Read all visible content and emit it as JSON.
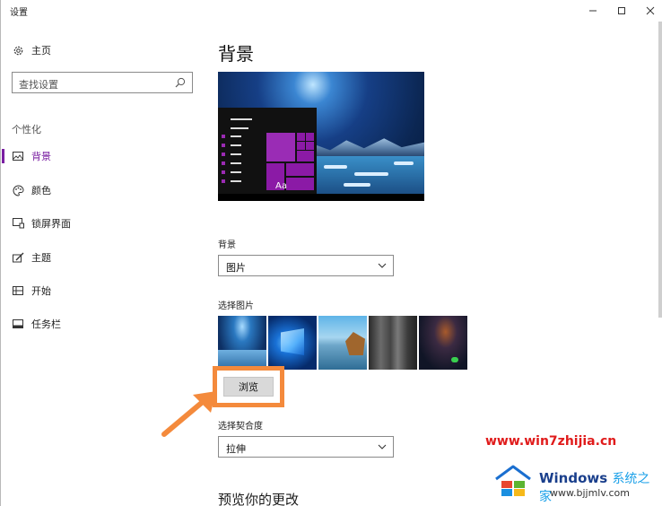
{
  "window": {
    "title": "设置"
  },
  "sidebar": {
    "home_label": "主页",
    "search_placeholder": "查找设置",
    "section_label": "个性化",
    "items": [
      {
        "label": "背景",
        "icon": "picture-icon",
        "active": true
      },
      {
        "label": "颜色",
        "icon": "palette-icon",
        "active": false
      },
      {
        "label": "锁屏界面",
        "icon": "lock-screen-icon",
        "active": false
      },
      {
        "label": "主题",
        "icon": "theme-brush-icon",
        "active": false
      },
      {
        "label": "开始",
        "icon": "start-menu-icon",
        "active": false
      },
      {
        "label": "任务栏",
        "icon": "taskbar-icon",
        "active": false
      }
    ]
  },
  "main": {
    "title": "背景",
    "preview_tile_text": "Aa",
    "background_label": "背景",
    "background_value": "图片",
    "choose_picture_label": "选择图片",
    "browse_label": "浏览",
    "fit_label": "选择契合度",
    "fit_value": "拉伸",
    "preview_changes_label": "预览你的更改"
  },
  "watermark": {
    "url": "www.win7zhijia.cn",
    "brand": "Windows",
    "brand_cn": "系统之家",
    "site": "www.bjjmlv.com"
  },
  "colors": {
    "accent": "#7a1fa2",
    "highlight_box": "#f48a3c",
    "watermark_red": "#e01b1b"
  }
}
